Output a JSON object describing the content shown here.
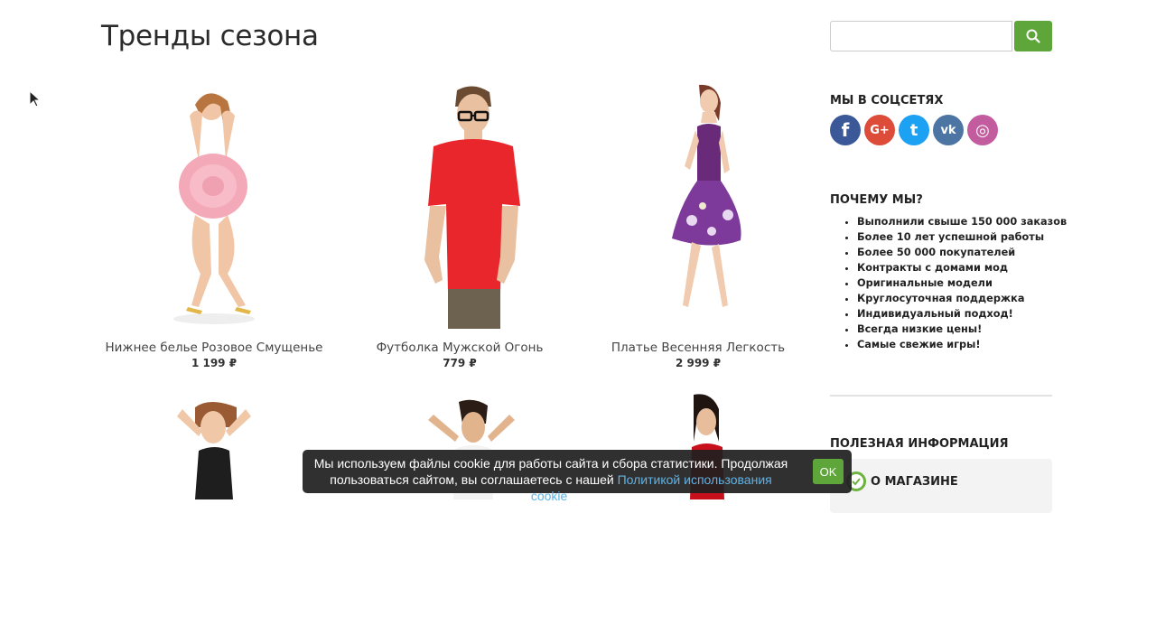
{
  "main": {
    "title": "Тренды сезона",
    "products": [
      {
        "name": "Нижнее белье Розовое Смущенье",
        "price": "1 199 ₽"
      },
      {
        "name": "Футболка Мужской Огонь",
        "price": "779 ₽"
      },
      {
        "name": "Платье Весенняя Легкость",
        "price": "2 999 ₽"
      }
    ]
  },
  "sidebar": {
    "search": {
      "placeholder": "",
      "value": ""
    },
    "social_title": "МЫ В СОЦСЕТЯХ",
    "social": [
      {
        "icon": "facebook-icon",
        "glyph": "f",
        "color": "#3b5998"
      },
      {
        "icon": "google-plus-icon",
        "glyph": "G+",
        "color": "#dd4b39"
      },
      {
        "icon": "twitter-icon",
        "glyph": "t",
        "color": "#1da1f2"
      },
      {
        "icon": "vk-icon",
        "glyph": "vk",
        "color": "#4c75a3"
      },
      {
        "icon": "instagram-icon",
        "glyph": "◎",
        "color": "#c35c9e"
      }
    ],
    "why_title": "ПОЧЕМУ МЫ?",
    "why_items": [
      "Выполнили свыше 150 000 заказов",
      "Более 10 лет успешной работы",
      "Более 50 000 покупателей",
      "Контракты с домами мод",
      "Оригинальные модели",
      "Круглосуточная поддержка",
      "Индивидуальный подход!",
      "Всегда низкие цены!",
      "Самые свежие игры!"
    ],
    "info_title": "ПОЛЕЗНАЯ ИНФОРМАЦИЯ",
    "about_label": "О МАГАЗИНЕ"
  },
  "cookie": {
    "text_before": "Мы используем файлы cookie для работы сайта и сбора статистики. Продолжая пользоваться сайтом, вы соглашаетесь с нашей ",
    "link_text": "Политикой использования cookie",
    "text_after": ".",
    "ok_label": "OK"
  },
  "colors": {
    "accent": "#5ea53a",
    "link": "#5fb3e6"
  }
}
